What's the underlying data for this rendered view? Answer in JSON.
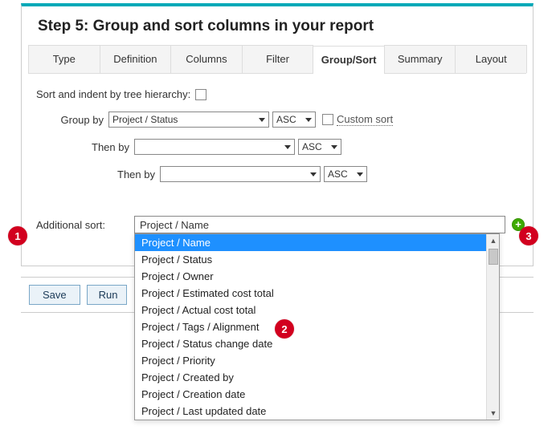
{
  "header": {
    "title": "Step 5: Group and sort columns in your report"
  },
  "tabs": [
    "Type",
    "Definition",
    "Columns",
    "Filter",
    "Group/Sort",
    "Summary",
    "Layout"
  ],
  "active_tab_index": 4,
  "tree_sort_label": "Sort and indent by tree hierarchy:",
  "group_by": {
    "label": "Group by",
    "field": "Project / Status",
    "order": "ASC",
    "custom_sort_label": "Custom sort"
  },
  "then_by_1": {
    "label": "Then by",
    "field": "",
    "order": "ASC"
  },
  "then_by_2": {
    "label": "Then by",
    "field": "",
    "order": "ASC"
  },
  "additional": {
    "label": "Additional sort:",
    "value": "Project / Name",
    "options": [
      "Project / Name",
      "Project / Status",
      "Project / Owner",
      "Project / Estimated cost total",
      "Project / Actual cost total",
      "Project / Tags / Alignment",
      "Project / Status change date",
      "Project / Priority",
      "Project / Created by",
      "Project / Creation date",
      "Project / Last updated date"
    ],
    "selected_index": 0
  },
  "buttons": {
    "save": "Save",
    "run": "Run"
  },
  "callouts": {
    "c1": "1",
    "c2": "2",
    "c3": "3"
  }
}
